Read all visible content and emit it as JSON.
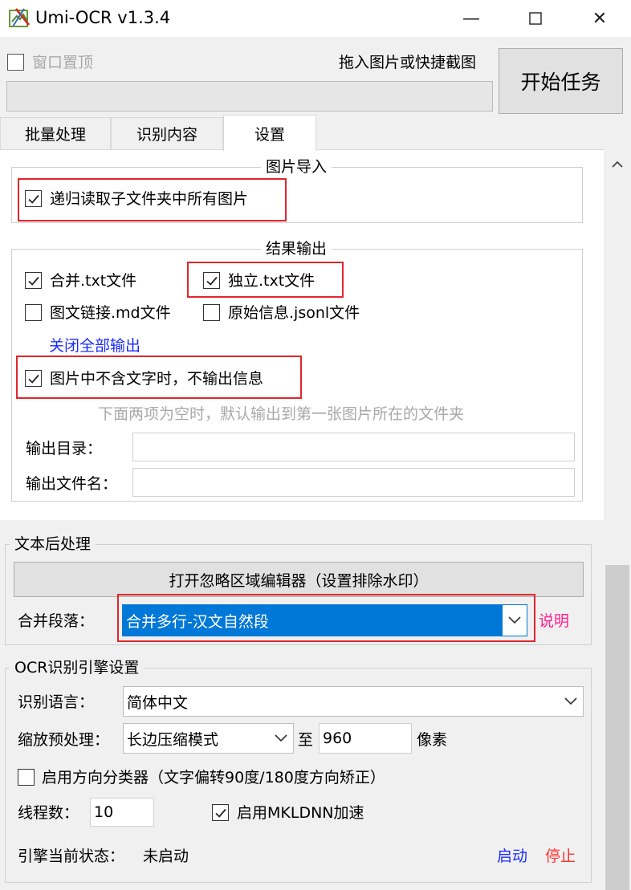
{
  "window": {
    "title": "Umi-OCR v1.3.4",
    "minimize_glyph": "—",
    "maximize_glyph": "☐",
    "close_glyph": "✕"
  },
  "top": {
    "topmost_label": "窗口置顶",
    "topmost_checked": false,
    "drop_hint": "拖入图片或快捷截图",
    "start_button": "开始任务"
  },
  "tabs": [
    {
      "label": "批量处理",
      "active": false
    },
    {
      "label": "识别内容",
      "active": false
    },
    {
      "label": "设置",
      "active": true
    }
  ],
  "image_import": {
    "title": "图片导入",
    "recursive_label": "递归读取子文件夹中所有图片",
    "recursive_checked": true
  },
  "result_output": {
    "title": "结果输出",
    "merge_txt_label": "合并.txt文件",
    "merge_txt_checked": true,
    "separate_txt_label": "独立.txt文件",
    "separate_txt_checked": true,
    "md_label": "图文链接.md文件",
    "md_checked": false,
    "jsonl_label": "原始信息.jsonl文件",
    "jsonl_checked": false,
    "close_all_link": "关闭全部输出",
    "no_text_label": "图片中不含文字时，不输出信息",
    "no_text_checked": true,
    "hint": "下面两项为空时，默认输出到第一张图片所在的文件夹",
    "dir_label": "输出目录：",
    "dir_value": "",
    "filename_label": "输出文件名：",
    "filename_value": ""
  },
  "post_process": {
    "title": "文本后处理",
    "ignore_editor_button": "打开忽略区域编辑器（设置排除水印）",
    "merge_label": "合并段落：",
    "merge_value": "合并多行-汉文自然段",
    "explain_link": "说明"
  },
  "engine": {
    "title": "OCR识别引擎设置",
    "language_label": "识别语言：",
    "language_value": "简体中文",
    "scale_label": "缩放预处理：",
    "scale_mode_value": "长边压缩模式",
    "to_label": "至",
    "scale_size_value": "960",
    "pixel_label": "像素",
    "direction_label": "启用方向分类器（文字偏转90度/180度方向矫正）",
    "direction_checked": false,
    "threads_label": "线程数：",
    "threads_value": "10",
    "mkldnn_label": "启用MKLDNN加速",
    "mkldnn_checked": true,
    "status_label": "引擎当前状态：",
    "status_value": "未启动",
    "start_link": "启动",
    "stop_link": "停止"
  },
  "colors": {
    "highlight_red": "#e0262c",
    "link_blue": "#1a2bff",
    "selection_blue": "#0078d7",
    "link_pink": "#ff1f8e"
  }
}
